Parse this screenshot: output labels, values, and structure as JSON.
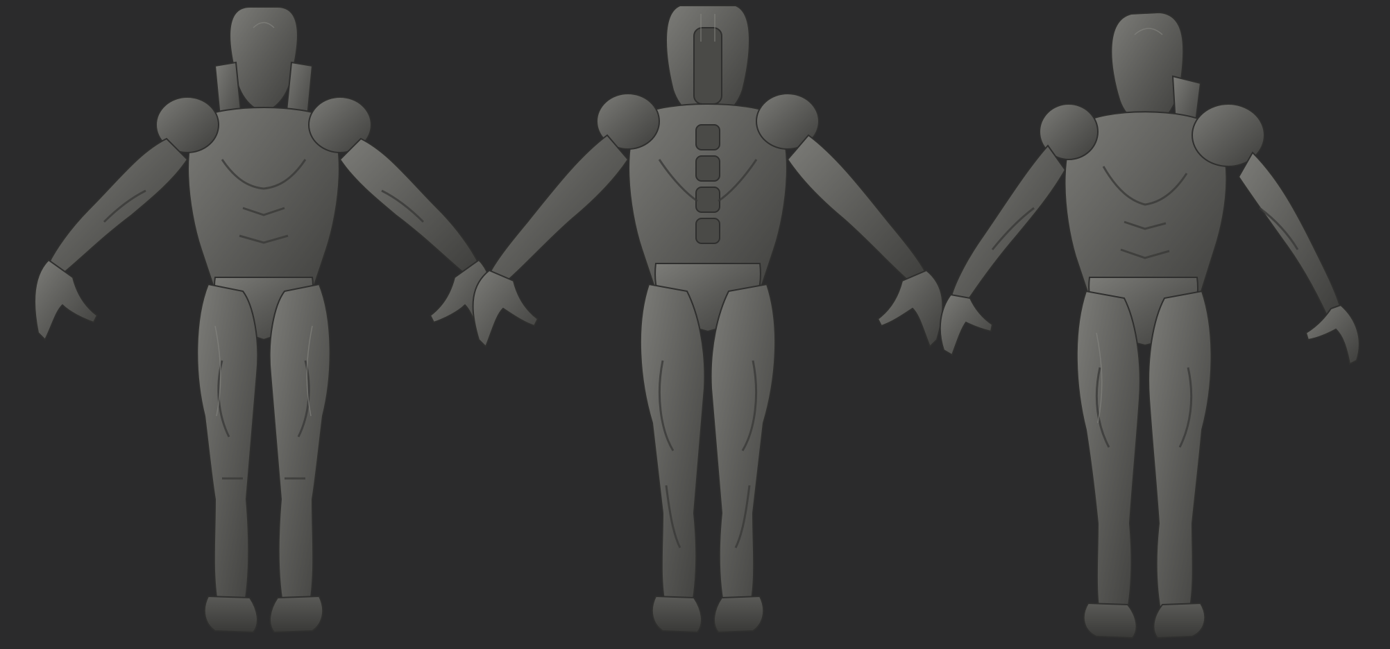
{
  "scene": {
    "background_color": "#2b2b2c",
    "material_color": "#5f5f5c",
    "highlight_color": "#8a8a85",
    "shadow_color": "#3a3a38"
  },
  "views": [
    {
      "name": "front",
      "icon": "armored-figure-front"
    },
    {
      "name": "back",
      "icon": "armored-figure-back"
    },
    {
      "name": "three-quarter",
      "icon": "armored-figure-three-quarter"
    }
  ]
}
